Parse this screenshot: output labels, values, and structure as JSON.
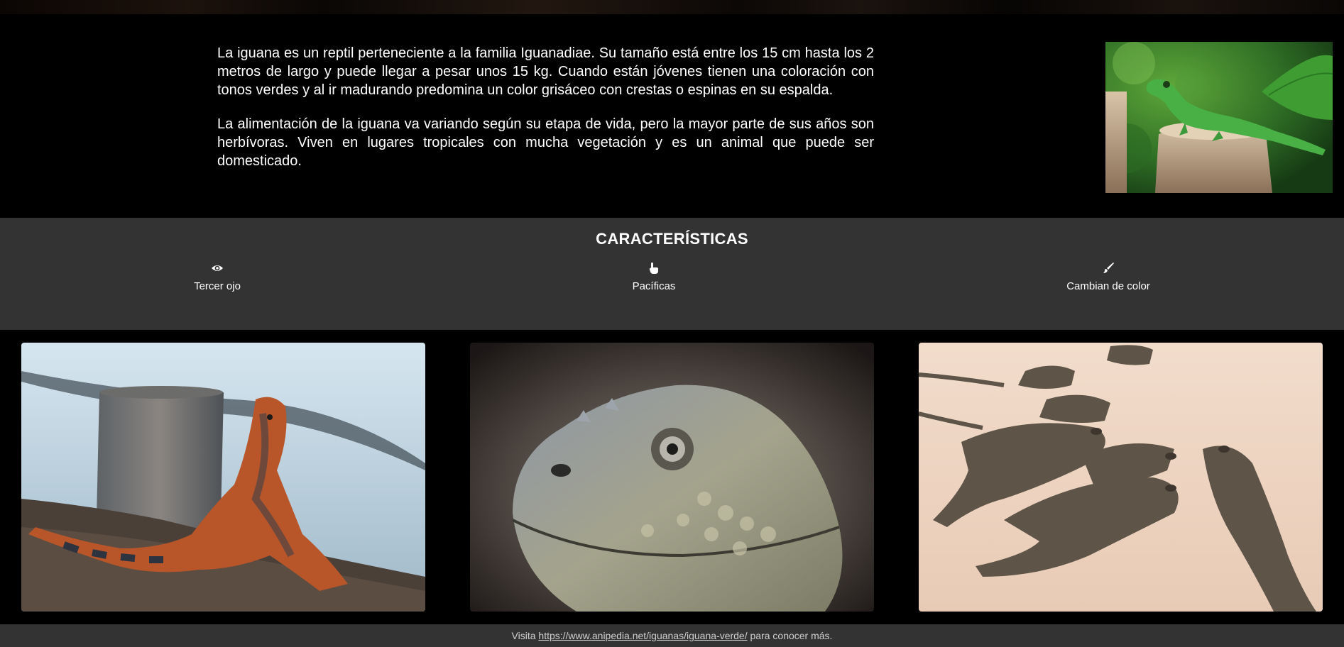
{
  "intro": {
    "paragraph_1": "La iguana es un reptil perteneciente a la familia Iguanadiae. Su tamaño está entre los 15 cm hasta los 2 metros de largo y puede llegar a pesar unos 15 kg. Cuando están jóvenes tienen una coloración con tonos verdes y al ir madurando predomina un color grisáceo con crestas o espinas en su espalda.",
    "paragraph_2": "La alimentación de la iguana va variando según su etapa de vida, pero la mayor parte de sus años son herbívoras. Viven en lugares tropicales con mucha vegetación y es un animal que puede ser domesticado."
  },
  "features": {
    "title": "CARACTERÍSTICAS",
    "items": [
      {
        "label": "Tercer ojo",
        "icon": "eye-icon"
      },
      {
        "label": "Pacíficas",
        "icon": "hand-pointer-icon"
      },
      {
        "label": "Cambian de color",
        "icon": "paint-brush-icon"
      }
    ]
  },
  "footer": {
    "prefix": "Visita",
    "link_text": "https://www.anipedia.net/iguanas/iguana-verde/",
    "suffix": "para conocer más."
  },
  "colors": {
    "page_background": "#000000",
    "band_background": "#333333",
    "text": "#ffffff",
    "footer_text": "#d0d0d0"
  }
}
